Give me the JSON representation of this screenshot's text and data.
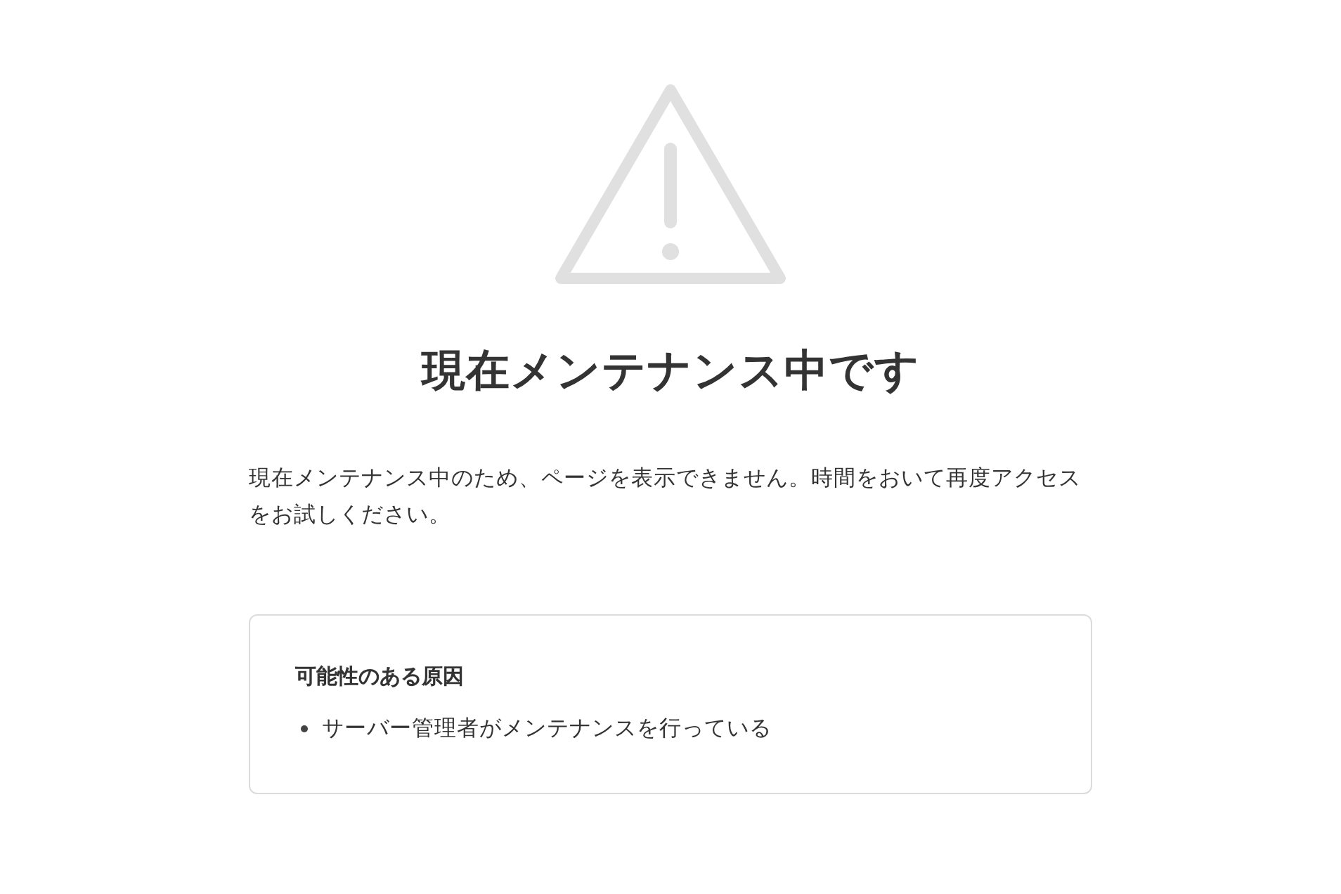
{
  "title": "現在メンテナンス中です",
  "message": "現在メンテナンス中のため、ページを表示できません。時間をおいて再度アクセスをお試しください。",
  "causes": {
    "heading": "可能性のある原因",
    "items": [
      "サーバー管理者がメンテナンスを行っている"
    ]
  }
}
